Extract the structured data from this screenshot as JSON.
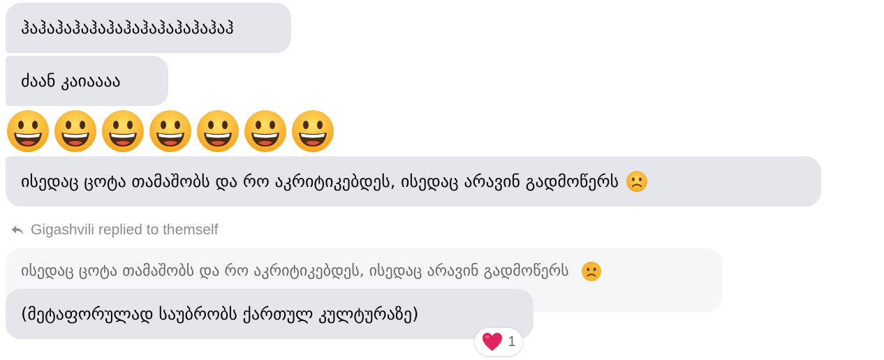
{
  "messages": [
    {
      "text": "ჰაჰაჰაჰაჰაჰაჰაჰაჰაჰაჰაჰაჰ"
    },
    {
      "text": "ძაან კაიაააა"
    },
    {
      "emoji_count": 7,
      "emoji": "grinning-face"
    },
    {
      "text": "ისედაც ცოტა თამაშობს და რო აკრიტიკებდეს, ისედაც არავინ გადმოწერს",
      "emoji": "frowning-face"
    }
  ],
  "reply": {
    "header": "Gigashvili replied to themself",
    "quoted_text": "ისედაც ცოტა თამაშობს და რო აკრიტიკებდეს, ისედაც არავინ გადმოწერს",
    "quoted_emoji": "frowning-face",
    "text": "(მეტაფორულად საუბრობს ქართულ კულტურაზე)"
  },
  "reaction": {
    "icon": "heart-icon",
    "count": "1"
  },
  "colors": {
    "bubble": "#e4e6eb",
    "quoted_bubble": "#f5f6f7",
    "muted_text": "#8a8d91",
    "heart": "#e0245e"
  }
}
